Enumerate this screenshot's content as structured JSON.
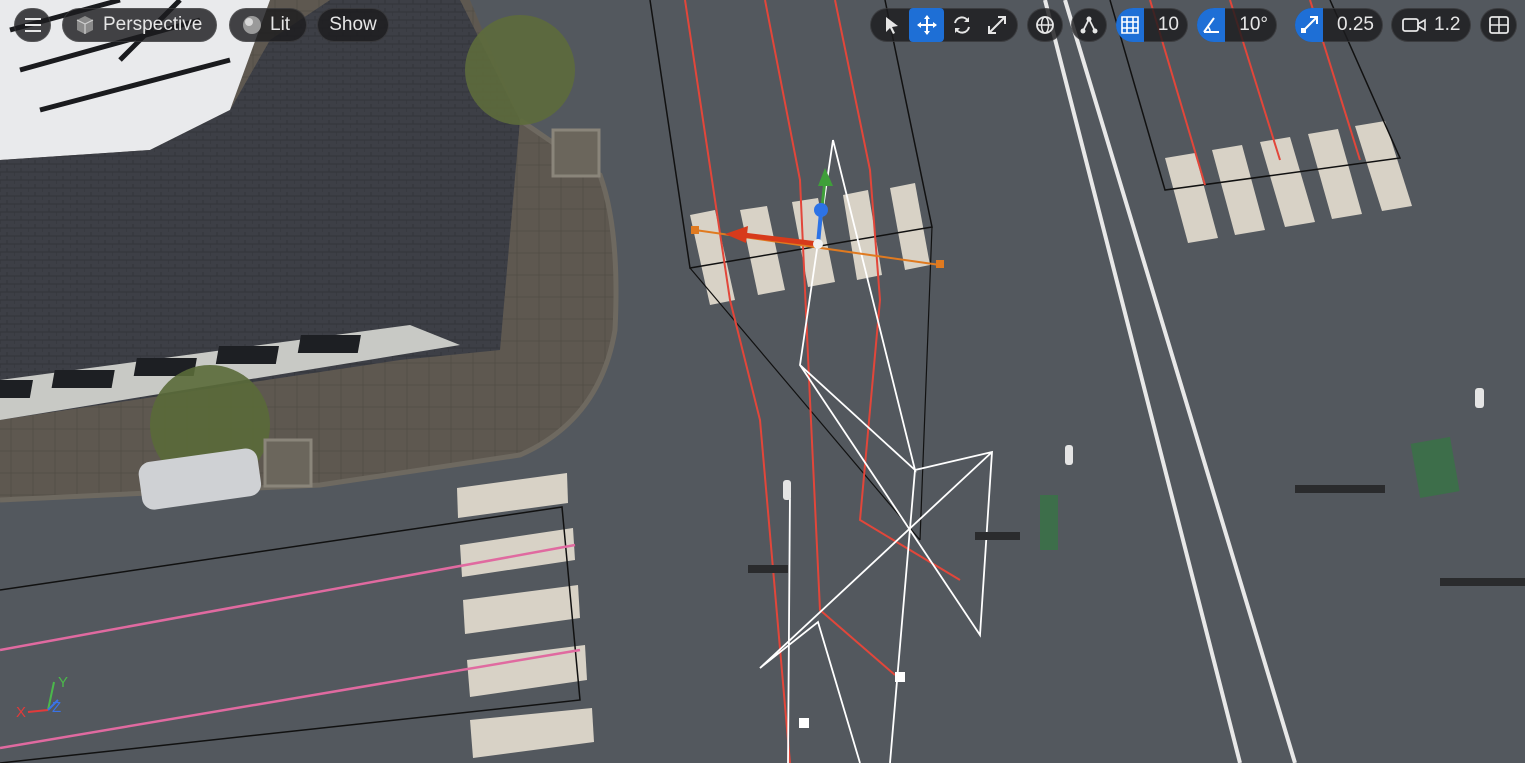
{
  "toolbar": {
    "menu_icon": "hamburger-icon",
    "view_mode_label": "Perspective",
    "view_mode_icon": "cube-icon",
    "lighting_label": "Lit",
    "lighting_icon": "sphere-icon",
    "show_label": "Show",
    "transform_tools": [
      {
        "name": "select",
        "icon": "cursor-icon",
        "active": false
      },
      {
        "name": "translate",
        "icon": "move-arrows-icon",
        "active": true
      },
      {
        "name": "rotate",
        "icon": "rotate-icon",
        "active": false
      },
      {
        "name": "scale",
        "icon": "scale-icon",
        "active": false
      }
    ],
    "world_local_icon": "globe-icon",
    "surface_snap_icon": "surface-snap-icon",
    "grid_snap_value": "10",
    "rotation_snap_value": "10°",
    "scale_snap_value": "0.25",
    "camera_speed_value": "1.2",
    "layout_icon": "viewport-layout-icon",
    "accent_color": "#1e6fd6"
  },
  "axis_indicator": {
    "x": "X",
    "y": "Y",
    "z": "Z"
  }
}
